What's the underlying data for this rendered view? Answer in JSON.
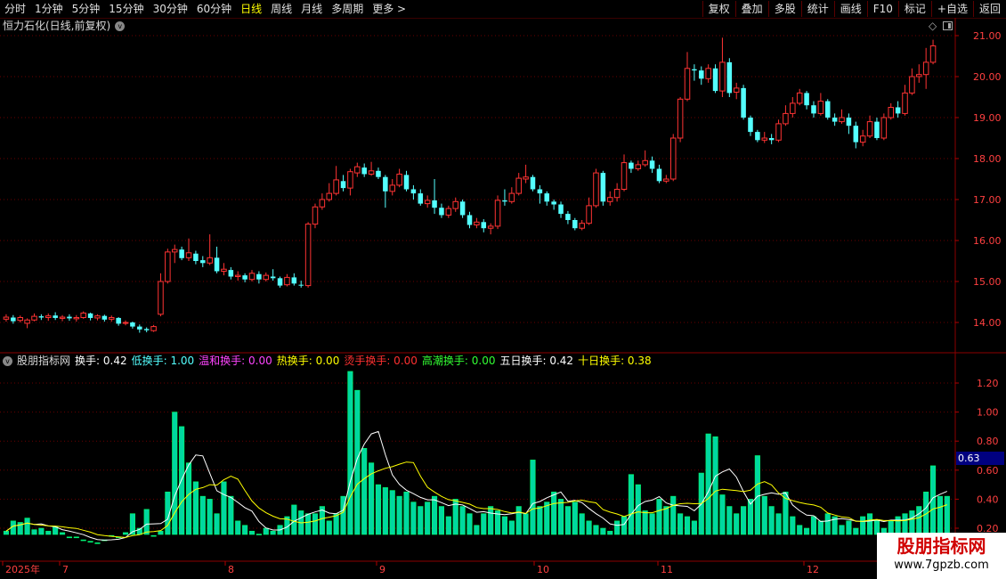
{
  "toolbar": {
    "periods": [
      "分时",
      "1分钟",
      "5分钟",
      "15分钟",
      "30分钟",
      "60分钟",
      "日线",
      "周线",
      "月线",
      "多周期",
      "更多 >"
    ],
    "active_period": "日线",
    "right_buttons": [
      "复权",
      "叠加",
      "多股",
      "统计",
      "画线",
      "F10",
      "标记",
      "+自选",
      "返回"
    ]
  },
  "price_panel": {
    "title": "恒力石化(日线,前复权)",
    "y_ticks": [
      "21.00",
      "20.00",
      "19.00",
      "18.00",
      "17.00",
      "16.00",
      "15.00",
      "14.00"
    ],
    "up_color": "#ff3333",
    "down_color": "#54ffff"
  },
  "indicator_panel": {
    "name": "股朋指标网",
    "legend": [
      {
        "label": "换手: 0.42",
        "color": "#ffffff"
      },
      {
        "label": "低换手: 1.00",
        "color": "#54ffff"
      },
      {
        "label": "温和换手: 0.00",
        "color": "#ff44ff"
      },
      {
        "label": "热换手: 0.00",
        "color": "#ffff00"
      },
      {
        "label": "烫手换手: 0.00",
        "color": "#ff3030"
      },
      {
        "label": "高潮换手: 0.00",
        "color": "#33ff33"
      },
      {
        "label": "五日换手: 0.42",
        "color": "#ffffff"
      },
      {
        "label": "十日换手: 0.38",
        "color": "#ffff00"
      }
    ],
    "y_ticks": [
      "1.20",
      "1.00",
      "0.80",
      "0.60",
      "0.40",
      "0.20"
    ],
    "current_value": "0.63"
  },
  "x_axis": {
    "labels": [
      "2025年",
      "7",
      "8",
      "9",
      "10",
      "11",
      "12"
    ]
  },
  "watermark": {
    "title": "股朋指标网",
    "url": "www.7gpzb.com"
  },
  "chart_data": {
    "type": "candlestick",
    "title": "恒力石化(日线,前复权)",
    "price_ylim": [
      13.5,
      21.3
    ],
    "candles": [
      [
        14.08,
        14.13,
        14.2,
        14.02
      ],
      [
        14.12,
        14.03,
        14.18,
        13.97
      ],
      [
        14.05,
        14.12,
        14.17,
        14.0
      ],
      [
        13.98,
        14.06,
        14.1,
        13.86
      ],
      [
        14.06,
        14.15,
        14.22,
        14.03
      ],
      [
        14.15,
        14.12,
        14.2,
        14.06
      ],
      [
        14.12,
        14.16,
        14.22,
        14.04
      ],
      [
        14.17,
        14.11,
        14.25,
        14.06
      ],
      [
        14.1,
        14.13,
        14.18,
        14.03
      ],
      [
        14.14,
        14.1,
        14.2,
        14.04
      ],
      [
        14.09,
        14.12,
        14.18,
        14.02
      ],
      [
        14.12,
        14.23,
        14.27,
        14.09
      ],
      [
        14.22,
        14.11,
        14.24,
        14.05
      ],
      [
        14.11,
        14.16,
        14.2,
        14.05
      ],
      [
        14.16,
        14.07,
        14.19,
        14.02
      ],
      [
        14.08,
        14.12,
        14.17,
        14.02
      ],
      [
        14.11,
        13.97,
        14.13,
        13.92
      ],
      [
        13.98,
        14.0,
        14.05,
        13.93
      ],
      [
        14.0,
        13.9,
        14.02,
        13.85
      ],
      [
        13.9,
        13.83,
        13.95,
        13.75
      ],
      [
        13.84,
        13.81,
        13.88,
        13.76
      ],
      [
        13.8,
        13.9,
        13.94,
        13.77
      ],
      [
        14.2,
        15.0,
        15.2,
        14.15
      ],
      [
        15.0,
        15.72,
        15.8,
        14.95
      ],
      [
        15.72,
        15.78,
        15.9,
        15.45
      ],
      [
        15.78,
        15.57,
        15.85,
        15.52
      ],
      [
        15.58,
        15.7,
        16.05,
        15.5
      ],
      [
        15.68,
        15.5,
        15.75,
        15.42
      ],
      [
        15.52,
        15.45,
        15.62,
        15.35
      ],
      [
        15.45,
        15.58,
        16.15,
        15.4
      ],
      [
        15.58,
        15.25,
        15.85,
        15.2
      ],
      [
        15.25,
        15.3,
        15.45,
        15.15
      ],
      [
        15.28,
        15.12,
        15.35,
        15.05
      ],
      [
        15.12,
        15.15,
        15.25,
        15.02
      ],
      [
        15.15,
        15.05,
        15.2,
        14.98
      ],
      [
        15.05,
        15.2,
        15.28,
        15.0
      ],
      [
        15.18,
        15.05,
        15.25,
        14.95
      ],
      [
        15.05,
        15.15,
        15.22,
        15.0
      ],
      [
        15.12,
        15.08,
        15.3,
        15.02
      ],
      [
        15.08,
        14.9,
        15.12,
        14.85
      ],
      [
        14.92,
        15.1,
        15.18,
        14.88
      ],
      [
        15.1,
        14.95,
        15.2,
        14.9
      ],
      [
        14.92,
        14.9,
        15.02,
        14.85
      ],
      [
        14.9,
        16.4,
        16.45,
        14.85
      ],
      [
        16.4,
        16.82,
        16.9,
        16.3
      ],
      [
        16.82,
        17.0,
        17.15,
        16.75
      ],
      [
        17.0,
        17.15,
        17.4,
        16.95
      ],
      [
        17.15,
        17.48,
        17.82,
        17.1
      ],
      [
        17.45,
        17.28,
        17.6,
        17.2
      ],
      [
        17.28,
        17.68,
        17.75,
        17.1
      ],
      [
        17.65,
        17.8,
        17.9,
        17.55
      ],
      [
        17.78,
        17.62,
        17.88,
        17.55
      ],
      [
        17.62,
        17.7,
        17.92,
        17.58
      ],
      [
        17.7,
        17.55,
        17.78,
        17.5
      ],
      [
        17.55,
        17.2,
        17.6,
        16.8
      ],
      [
        17.2,
        17.35,
        17.5,
        17.1
      ],
      [
        17.35,
        17.62,
        17.75,
        17.3
      ],
      [
        17.6,
        17.25,
        17.7,
        17.2
      ],
      [
        17.25,
        17.15,
        17.35,
        17.0
      ],
      [
        17.15,
        16.9,
        17.25,
        16.85
      ],
      [
        16.9,
        16.98,
        17.1,
        16.8
      ],
      [
        16.98,
        16.8,
        17.5,
        16.65
      ],
      [
        16.8,
        16.62,
        16.9,
        16.55
      ],
      [
        16.62,
        16.78,
        16.85,
        16.55
      ],
      [
        16.78,
        16.95,
        17.05,
        16.7
      ],
      [
        16.95,
        16.62,
        17.0,
        16.55
      ],
      [
        16.62,
        16.38,
        16.7,
        16.3
      ],
      [
        16.38,
        16.45,
        16.55,
        16.3
      ],
      [
        16.45,
        16.3,
        16.52,
        16.2
      ],
      [
        16.3,
        16.35,
        16.42,
        16.15
      ],
      [
        16.35,
        16.98,
        17.1,
        16.28
      ],
      [
        16.98,
        16.95,
        17.25,
        16.85
      ],
      [
        16.95,
        17.15,
        17.3,
        16.9
      ],
      [
        17.15,
        17.52,
        17.65,
        17.1
      ],
      [
        17.5,
        17.55,
        17.85,
        17.4
      ],
      [
        17.55,
        17.25,
        17.6,
        17.2
      ],
      [
        17.25,
        17.15,
        17.35,
        16.9
      ],
      [
        17.15,
        16.95,
        17.2,
        16.85
      ],
      [
        16.95,
        16.88,
        17.0,
        16.75
      ],
      [
        16.88,
        16.65,
        16.95,
        16.55
      ],
      [
        16.65,
        16.5,
        16.72,
        16.4
      ],
      [
        16.5,
        16.3,
        16.55,
        16.25
      ],
      [
        16.3,
        16.42,
        16.5,
        16.25
      ],
      [
        16.42,
        16.85,
        17.05,
        16.38
      ],
      [
        16.85,
        17.65,
        17.75,
        16.8
      ],
      [
        17.65,
        16.95,
        17.7,
        16.85
      ],
      [
        16.95,
        17.05,
        17.2,
        16.85
      ],
      [
        17.05,
        17.25,
        17.4,
        16.95
      ],
      [
        17.25,
        17.9,
        18.1,
        17.2
      ],
      [
        17.9,
        17.75,
        17.95,
        17.65
      ],
      [
        17.75,
        17.85,
        17.95,
        17.7
      ],
      [
        17.85,
        17.95,
        18.2,
        17.8
      ],
      [
        17.95,
        17.75,
        18.05,
        17.65
      ],
      [
        17.75,
        17.45,
        17.85,
        17.4
      ],
      [
        17.45,
        17.5,
        17.6,
        17.4
      ],
      [
        17.5,
        18.5,
        18.6,
        17.45
      ],
      [
        18.5,
        19.45,
        19.5,
        18.4
      ],
      [
        19.45,
        20.2,
        20.6,
        19.4
      ],
      [
        20.18,
        20.15,
        20.3,
        19.9
      ],
      [
        20.15,
        19.95,
        20.25,
        19.8
      ],
      [
        19.95,
        20.2,
        20.3,
        19.85
      ],
      [
        20.2,
        19.65,
        20.3,
        19.6
      ],
      [
        19.65,
        20.35,
        20.95,
        19.5
      ],
      [
        20.35,
        19.6,
        20.45,
        19.5
      ],
      [
        19.62,
        19.72,
        19.85,
        19.45
      ],
      [
        19.72,
        19.0,
        19.8,
        18.95
      ],
      [
        19.0,
        18.65,
        19.05,
        18.55
      ],
      [
        18.65,
        18.45,
        18.7,
        18.4
      ],
      [
        18.45,
        18.5,
        18.65,
        18.38
      ],
      [
        18.5,
        18.45,
        18.6,
        18.35
      ],
      [
        18.45,
        18.85,
        18.95,
        18.4
      ],
      [
        18.85,
        19.1,
        19.3,
        18.8
      ],
      [
        19.1,
        19.35,
        19.5,
        19.0
      ],
      [
        19.35,
        19.6,
        19.7,
        19.3
      ],
      [
        19.6,
        19.3,
        19.65,
        19.2
      ],
      [
        19.3,
        19.1,
        19.4,
        19.0
      ],
      [
        19.1,
        19.4,
        19.6,
        19.05
      ],
      [
        19.4,
        19.0,
        19.45,
        18.95
      ],
      [
        19.0,
        18.9,
        19.1,
        18.8
      ],
      [
        18.9,
        19.0,
        19.2,
        18.85
      ],
      [
        19.0,
        18.8,
        19.1,
        18.6
      ],
      [
        18.8,
        18.4,
        18.9,
        18.25
      ],
      [
        18.4,
        18.55,
        18.7,
        18.3
      ],
      [
        18.55,
        18.9,
        19.05,
        18.5
      ],
      [
        18.9,
        18.5,
        19.0,
        18.45
      ],
      [
        18.5,
        19.0,
        19.1,
        18.45
      ],
      [
        19.0,
        19.25,
        19.35,
        18.95
      ],
      [
        19.25,
        19.1,
        19.4,
        19.0
      ],
      [
        19.1,
        19.6,
        19.8,
        19.05
      ],
      [
        19.6,
        20.0,
        20.2,
        19.55
      ],
      [
        20.0,
        20.05,
        20.3,
        19.85
      ],
      [
        20.05,
        20.35,
        20.7,
        19.7
      ],
      [
        20.35,
        20.75,
        20.9,
        20.3
      ]
    ],
    "turnover_ylim": [
      0.17,
      1.35
    ],
    "turnover": [
      0.18,
      0.25,
      0.24,
      0.27,
      0.19,
      0.2,
      0.18,
      0.21,
      0.17,
      0.14,
      0.14,
      0.12,
      0.11,
      0.1,
      0.12,
      0.15,
      0.14,
      0.17,
      0.3,
      0.2,
      0.33,
      0.15,
      0.18,
      0.45,
      1.0,
      0.9,
      0.65,
      0.52,
      0.42,
      0.4,
      0.3,
      0.52,
      0.42,
      0.25,
      0.22,
      0.18,
      0.16,
      0.2,
      0.18,
      0.22,
      0.28,
      0.36,
      0.32,
      0.3,
      0.3,
      0.35,
      0.25,
      0.3,
      0.42,
      1.28,
      1.15,
      0.75,
      0.65,
      0.5,
      0.48,
      0.46,
      0.42,
      0.45,
      0.38,
      0.35,
      0.38,
      0.42,
      0.35,
      0.28,
      0.4,
      0.35,
      0.3,
      0.22,
      0.3,
      0.35,
      0.32,
      0.28,
      0.25,
      0.35,
      0.3,
      0.67,
      0.35,
      0.38,
      0.45,
      0.4,
      0.35,
      0.38,
      0.3,
      0.25,
      0.22,
      0.2,
      0.18,
      0.25,
      0.28,
      0.57,
      0.5,
      0.32,
      0.3,
      0.4,
      0.35,
      0.42,
      0.3,
      0.28,
      0.25,
      0.58,
      0.85,
      0.83,
      0.43,
      0.35,
      0.3,
      0.35,
      0.4,
      0.7,
      0.42,
      0.35,
      0.3,
      0.45,
      0.28,
      0.22,
      0.2,
      0.28,
      0.25,
      0.3,
      0.28,
      0.22,
      0.25,
      0.2,
      0.28,
      0.3,
      0.25,
      0.2,
      0.25,
      0.28,
      0.3,
      0.32,
      0.35,
      0.45,
      0.63,
      0.42,
      0.42
    ]
  }
}
